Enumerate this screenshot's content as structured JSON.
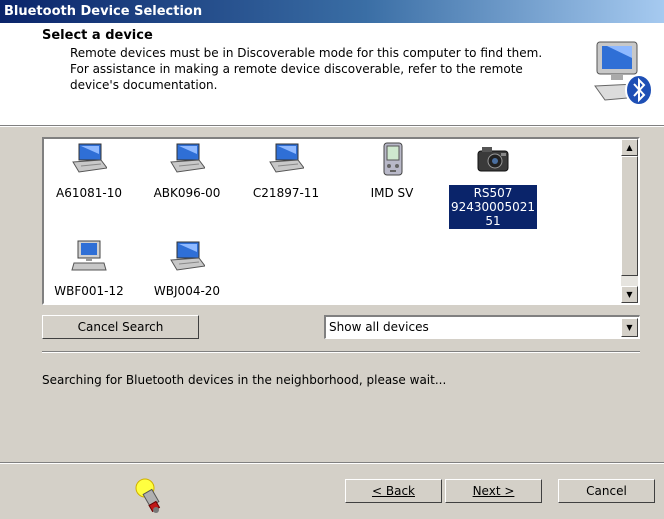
{
  "window": {
    "title": "Bluetooth Device Selection"
  },
  "header": {
    "title": "Select a device",
    "line1": "Remote devices must be in Discoverable mode for this computer to find them.",
    "line2": "For assistance in making a remote device discoverable, refer to the remote",
    "line3": "device's documentation.",
    "logo_icon": "bluetooth-computer-icon"
  },
  "devices": [
    {
      "label": "A61081-10",
      "icon": "laptop-icon",
      "selected": false
    },
    {
      "label": "ABK096-00",
      "icon": "laptop-icon",
      "selected": false
    },
    {
      "label": "C21897-11",
      "icon": "laptop-icon",
      "selected": false
    },
    {
      "label": "IMD SV",
      "icon": "pda-icon",
      "selected": false
    },
    {
      "label_lines": [
        "RS507",
        "92430005021",
        "51"
      ],
      "icon": "camera-icon",
      "selected": true
    },
    {
      "label": "WBF001-12",
      "icon": "desktop-computer-icon",
      "selected": false
    },
    {
      "label": "WBJ004-20",
      "icon": "laptop-icon",
      "selected": false
    }
  ],
  "controls": {
    "cancel_search": "Cancel Search",
    "filter_value": "Show all devices"
  },
  "status": "Searching for Bluetooth devices in the neighborhood, please wait...",
  "footer": {
    "back_label": "< Back",
    "next_label": "Next >",
    "cancel_label": "Cancel",
    "hint_icon": "lightbulb-icon"
  },
  "colors": {
    "titlebar": "#0a246a",
    "selection": "#0a246a",
    "dialog": "#d4d0c8"
  }
}
